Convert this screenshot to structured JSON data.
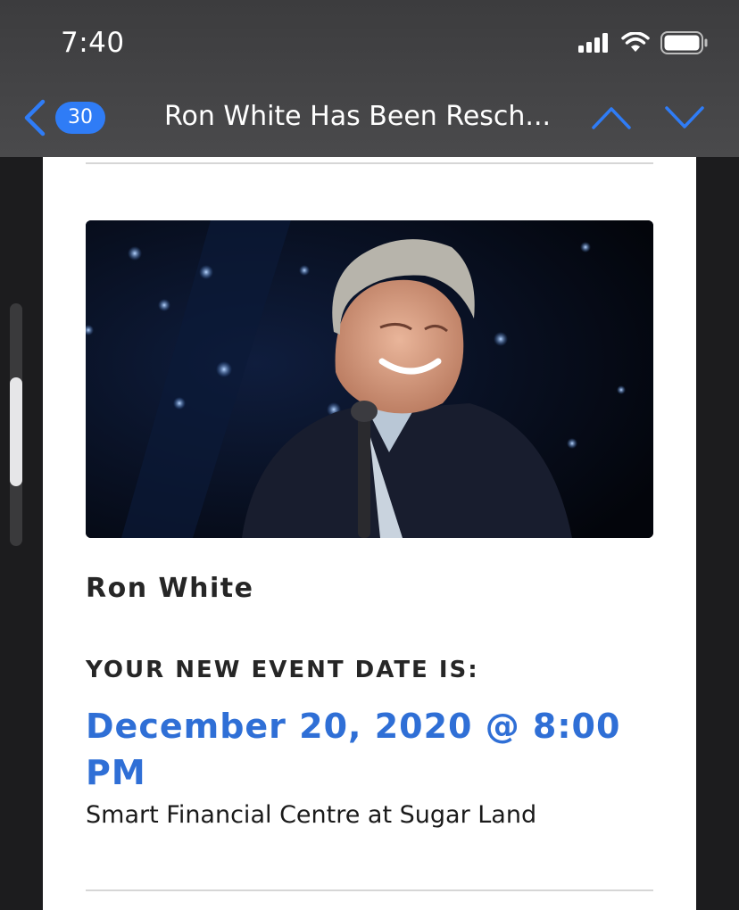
{
  "status_bar": {
    "time": "7:40",
    "icons": [
      "signal-icon",
      "wifi-icon",
      "battery-icon"
    ]
  },
  "nav": {
    "back_icon": "chevron-left-icon",
    "unread_count": "30",
    "title": "Ron White Has Been Resch...",
    "prev_icon": "chevron-up-icon",
    "next_icon": "chevron-down-icon",
    "accent_color": "#2f7cf6"
  },
  "email": {
    "hero_image": "ron-white-on-stage-photo",
    "artist": "Ron White",
    "new_date_label": "YOUR NEW EVENT DATE IS:",
    "new_date": "December 20, 2020 @ 8:00 PM",
    "venue": "Smart Financial Centre at Sugar Land",
    "date_color": "#2f6fd6"
  },
  "scrollbar": {
    "position_fraction": 0.55
  }
}
